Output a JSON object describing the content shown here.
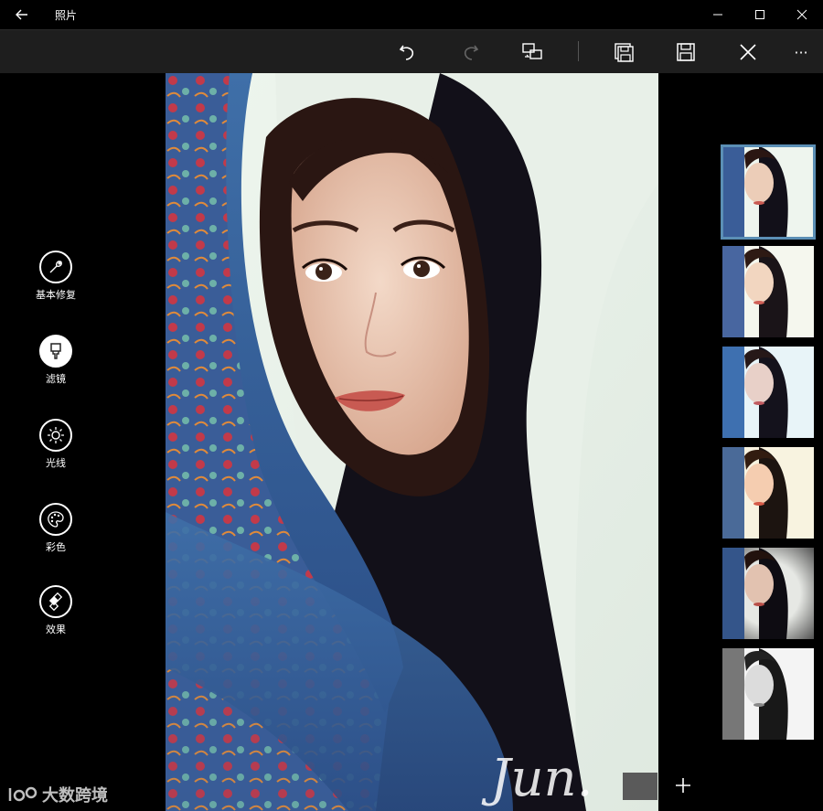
{
  "window": {
    "title": "照片"
  },
  "toolbar": {
    "undo": "undo-icon",
    "redo": "redo-icon",
    "compare": "compare-icon",
    "save_copy": "save-copy-icon",
    "save": "save-icon",
    "cancel": "close-icon",
    "more": "···"
  },
  "tools": [
    {
      "label": "基本修复",
      "icon": "wrench-icon",
      "active": false
    },
    {
      "label": "滤镜",
      "icon": "brush-icon",
      "active": true
    },
    {
      "label": "光线",
      "icon": "sun-icon",
      "active": false
    },
    {
      "label": "彩色",
      "icon": "palette-icon",
      "active": false
    },
    {
      "label": "效果",
      "icon": "effects-icon",
      "active": false
    }
  ],
  "photo": {
    "signature": "Jun."
  },
  "filters": [
    {
      "name": "original",
      "selected": true
    },
    {
      "name": "filter-1",
      "selected": false
    },
    {
      "name": "filter-2",
      "selected": false
    },
    {
      "name": "filter-3",
      "selected": false
    },
    {
      "name": "filter-4",
      "selected": false
    },
    {
      "name": "filter-bw",
      "selected": false
    }
  ],
  "add_button": "+",
  "watermark": {
    "text": "大数跨境"
  },
  "colors": {
    "toolbar_bg": "#1e1e1e",
    "selected_outline": "#5b8fb5",
    "background": "#000000"
  }
}
